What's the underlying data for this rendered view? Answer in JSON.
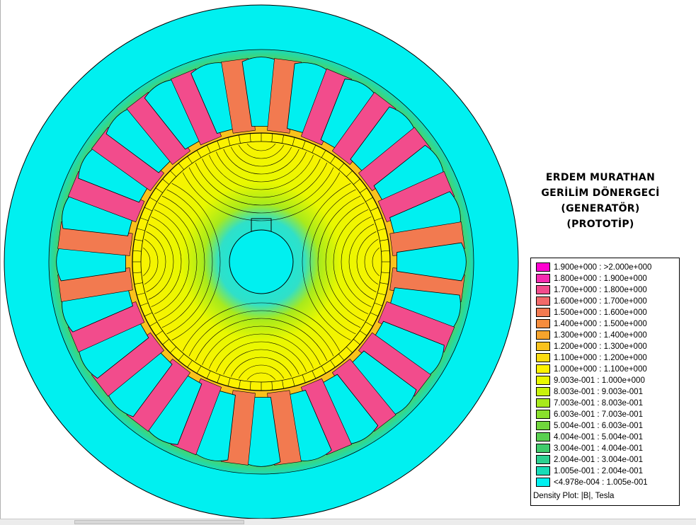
{
  "title": {
    "line1": "ERDEM MURATHAN",
    "line2": "GERİLİM DÖNERGECİ",
    "line3": "(GENERATÖR)",
    "line4": "(PROTOTİP)"
  },
  "legend": {
    "caption": "Density Plot: |B|, Tesla",
    "entries": [
      {
        "label": "1.900e+000 : >2.000e+000",
        "color": "#ff00d0"
      },
      {
        "label": "1.800e+000 : 1.900e+000",
        "color": "#f52cb0"
      },
      {
        "label": "1.700e+000 : 1.800e+000",
        "color": "#f24c8c"
      },
      {
        "label": "1.600e+000 : 1.700e+000",
        "color": "#f26a6a"
      },
      {
        "label": "1.500e+000 : 1.600e+000",
        "color": "#f27a50"
      },
      {
        "label": "1.400e+000 : 1.500e+000",
        "color": "#f58c3c"
      },
      {
        "label": "1.300e+000 : 1.400e+000",
        "color": "#f7a42c"
      },
      {
        "label": "1.200e+000 : 1.300e+000",
        "color": "#f9c21c"
      },
      {
        "label": "1.100e+000 : 1.200e+000",
        "color": "#fbdc10"
      },
      {
        "label": "1.000e+000 : 1.100e+000",
        "color": "#fdf200"
      },
      {
        "label": "9.003e-001 : 1.000e+000",
        "color": "#e8f800"
      },
      {
        "label": "8.003e-001 : 9.003e-001",
        "color": "#c8f20c"
      },
      {
        "label": "7.003e-001 : 8.003e-001",
        "color": "#a8ea1c"
      },
      {
        "label": "6.003e-001 : 7.003e-001",
        "color": "#8ae02c"
      },
      {
        "label": "5.004e-001 : 6.003e-001",
        "color": "#70d63c"
      },
      {
        "label": "4.004e-001 : 5.004e-001",
        "color": "#58d050"
      },
      {
        "label": "3.004e-001 : 4.004e-001",
        "color": "#40cc6c"
      },
      {
        "label": "2.004e-001 : 3.004e-001",
        "color": "#2cd090"
      },
      {
        "label": "1.005e-001 : 2.004e-001",
        "color": "#18dcb8"
      },
      {
        "label": "<4.978e-004 : 1.005e-001",
        "color": "#00f0f0"
      }
    ]
  },
  "colors": {
    "stator_outer": "#00f0f0",
    "yoke": "#e8d818",
    "rotor": "#e8f800",
    "rotor_center": "#30e0c8",
    "slot": "#00f0f0",
    "tooth": "#f27a50",
    "tooth_peak": "#f24c8c",
    "line": "#000000"
  }
}
